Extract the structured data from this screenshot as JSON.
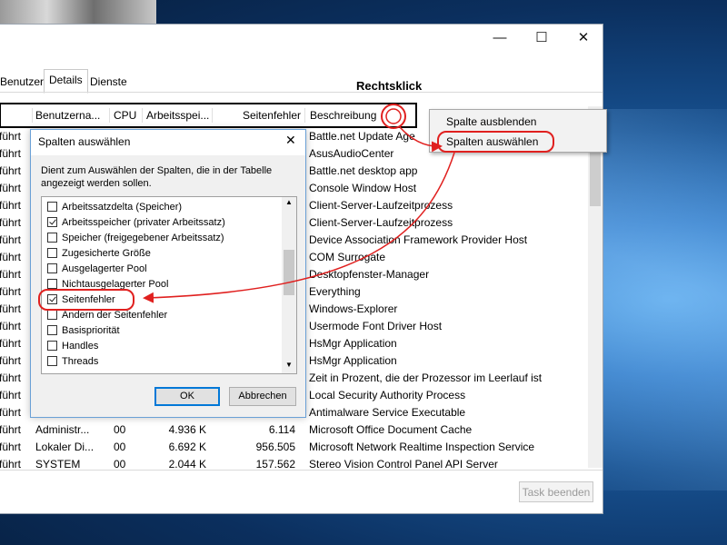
{
  "window": {
    "minimize_glyph": "—",
    "maximize_glyph": "☐",
    "close_glyph": "✕"
  },
  "tabs": [
    {
      "label": "Benutzer"
    },
    {
      "label": "Details"
    },
    {
      "label": "Dienste"
    }
  ],
  "columns": [
    "Benutzerna...",
    "CPU",
    "Arbeitsspei...",
    "Seitenfehler",
    "Beschreibung"
  ],
  "rows": [
    {
      "status": "führt",
      "user": "",
      "cpu": "",
      "mem": "",
      "faults": "",
      "desc": "Battle.net Update Age"
    },
    {
      "status": "führt",
      "user": "",
      "cpu": "",
      "mem": "",
      "faults": "",
      "desc": "AsusAudioCenter"
    },
    {
      "status": "führt",
      "user": "",
      "cpu": "",
      "mem": "",
      "faults": "",
      "desc": "Battle.net desktop app"
    },
    {
      "status": "führt",
      "user": "",
      "cpu": "",
      "mem": "",
      "faults": "",
      "desc": "Console Window Host"
    },
    {
      "status": "führt",
      "user": "",
      "cpu": "",
      "mem": "",
      "faults": "",
      "desc": "Client-Server-Laufzeitprozess"
    },
    {
      "status": "führt",
      "user": "",
      "cpu": "",
      "mem": "",
      "faults": "",
      "desc": "Client-Server-Laufzeitprozess"
    },
    {
      "status": "führt",
      "user": "",
      "cpu": "",
      "mem": "",
      "faults": "",
      "desc": "Device Association Framework Provider Host"
    },
    {
      "status": "führt",
      "user": "",
      "cpu": "",
      "mem": "",
      "faults": "",
      "desc": "COM Surrogate"
    },
    {
      "status": "führt",
      "user": "",
      "cpu": "",
      "mem": "",
      "faults": "",
      "desc": "Desktopfenster-Manager"
    },
    {
      "status": "führt",
      "user": "",
      "cpu": "",
      "mem": "",
      "faults": "",
      "desc": "Everything"
    },
    {
      "status": "führt",
      "user": "",
      "cpu": "",
      "mem": "",
      "faults": "",
      "desc": "Windows-Explorer"
    },
    {
      "status": "führt",
      "user": "",
      "cpu": "",
      "mem": "",
      "faults": "",
      "desc": "Usermode Font Driver Host"
    },
    {
      "status": "führt",
      "user": "",
      "cpu": "",
      "mem": "",
      "faults": "",
      "desc": "HsMgr Application"
    },
    {
      "status": "führt",
      "user": "",
      "cpu": "",
      "mem": "",
      "faults": "",
      "desc": "HsMgr Application"
    },
    {
      "status": "führt",
      "user": "",
      "cpu": "",
      "mem": "",
      "faults": "",
      "desc": "Zeit in Prozent, die der Prozessor im Leerlauf ist"
    },
    {
      "status": "führt",
      "user": "",
      "cpu": "",
      "mem": "",
      "faults": "",
      "desc": "Local Security Authority Process"
    },
    {
      "status": "führt",
      "user": "",
      "cpu": "",
      "mem": "",
      "faults": "",
      "desc": "Antimalware Service Executable"
    },
    {
      "status": "führt",
      "user": "Administr...",
      "cpu": "00",
      "mem": "4.936 K",
      "faults": "6.114",
      "desc": "Microsoft Office Document Cache"
    },
    {
      "status": "führt",
      "user": "Lokaler Di...",
      "cpu": "00",
      "mem": "6.692 K",
      "faults": "956.505",
      "desc": "Microsoft Network Realtime Inspection Service"
    },
    {
      "status": "führt",
      "user": "SYSTEM",
      "cpu": "00",
      "mem": "2.044 K",
      "faults": "157.562",
      "desc": "Stereo Vision Control Panel API Server"
    }
  ],
  "task_end_label": "Task beenden",
  "annotation_label": "Rechtsklick",
  "context_menu": [
    {
      "label": "Spalte ausblenden"
    },
    {
      "label": "Spalten auswählen"
    }
  ],
  "dialog": {
    "title": "Spalten auswählen",
    "close_glyph": "✕",
    "description": "Dient zum Auswählen der Spalten, die in der Tabelle angezeigt werden sollen.",
    "items": [
      {
        "label": "Arbeitssatzdelta (Speicher)",
        "checked": false
      },
      {
        "label": "Arbeitsspeicher (privater Arbeitssatz)",
        "checked": true
      },
      {
        "label": "Speicher (freigegebener Arbeitssatz)",
        "checked": false
      },
      {
        "label": "Zugesicherte Größe",
        "checked": false
      },
      {
        "label": "Ausgelagerter Pool",
        "checked": false
      },
      {
        "label": "Nichtausgelagerter Pool",
        "checked": false
      },
      {
        "label": "Seitenfehler",
        "checked": true
      },
      {
        "label": "Ändern der Seitenfehler",
        "checked": false
      },
      {
        "label": "Basispriorität",
        "checked": false
      },
      {
        "label": "Handles",
        "checked": false
      },
      {
        "label": "Threads",
        "checked": false
      }
    ],
    "ok_label": "OK",
    "cancel_label": "Abbrechen"
  },
  "colors": {
    "highlight": "#e0201f",
    "accent": "#0078d7"
  }
}
